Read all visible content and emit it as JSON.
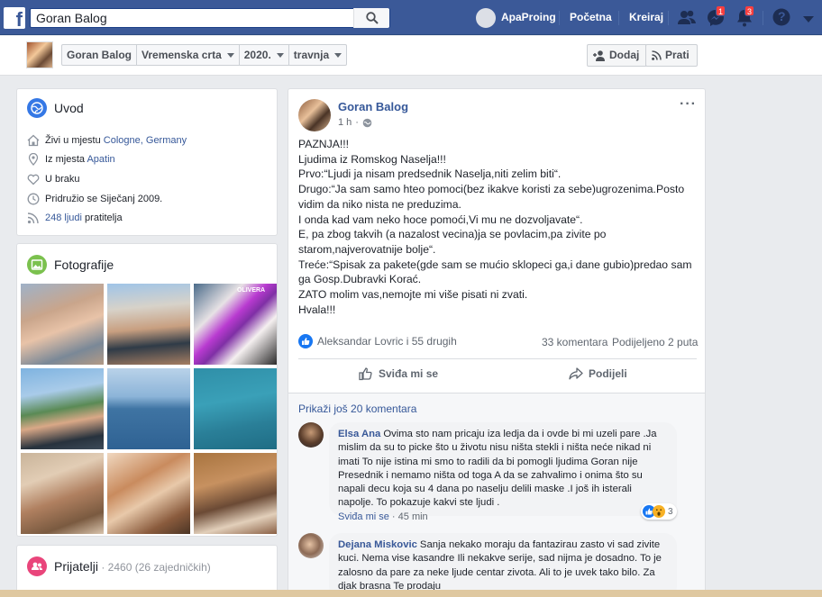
{
  "topbar": {
    "search_value": "Goran Balog",
    "profile_name": "ApaProing",
    "home_label": "Početna",
    "create_label": "Kreiraj",
    "messenger_badge": "1",
    "notifications_badge": "3",
    "help_glyph": "?",
    "icons": [
      "facebook-logo",
      "search-icon",
      "friends-icon",
      "messenger-icon",
      "bell-icon",
      "help-icon",
      "dropdown-icon"
    ]
  },
  "timeline_bar": {
    "name": "Goran Balog",
    "section": "Vremenska crta",
    "year": "2020.",
    "month": "travnja",
    "add_label": "Dodaj",
    "follow_label": "Prati"
  },
  "intro": {
    "title": "Uvod",
    "lives_prefix": "Živi u mjestu ",
    "lives_place": "Cologne, Germany",
    "from_prefix": "Iz mjesta ",
    "from_place": "Apatin",
    "relationship": "U braku",
    "joined": "Pridružio se Siječanj 2009.",
    "followers_link": "248 ljudi",
    "followers_suffix": " pratitelja"
  },
  "photos": {
    "title": "Fotografije",
    "collage_caption": "OLIVERA"
  },
  "friends": {
    "title": "Prijatelji",
    "count": " · 2460 (26 zajedničkih)"
  },
  "post": {
    "author": "Goran Balog",
    "time": "1 h",
    "lines": [
      "PAZNJA!!!",
      "Ljudima iz Romskog Naselja!!!",
      "Prvo:“Ljudi ja nisam predsednik Naselja,niti zelim biti“.",
      "Drugo:“Ja sam samo hteo pomoci(bez ikakve koristi za sebe)ugrozenima.Posto vidim da niko nista ne preduzima.",
      "I onda kad vam neko hoce pomoći,Vi mu ne dozvoljavate“.",
      "E, pa zbog takvih (a nazalost vecina)ja se povlacim,pa zivite po starom,najverovatnije bolje“.",
      "Treće:“Spisak za pakete(gde sam se mućio sklopeci ga,i dane gubio)predao sam ga Gosp.Dubravki Korać.",
      "ZATO molim vas,nemojte mi više pisati ni zvati.",
      "Hvala!!!"
    ],
    "reactions": "Aleksandar Lovric i 55 drugih",
    "comments_count": "33 komentara",
    "shares": "Podijeljeno 2 puta",
    "like_label": "Sviđa mi se",
    "share_label": "Podijeli",
    "more_comments": "Prikaži još 20 komentara",
    "options_glyph": "···"
  },
  "comments": [
    {
      "author": "Elsa Ana",
      "text": "Ovima sto nam pricaju iza ledja da i ovde bi mi uzeli pare .Ja mislim da su to picke što u životu nisu ništa stekli i ništa neće nikad ni imati To nije istina mi smo to radili da bi pomogli ljudima Goran nije Presednik i nemamo ništa od toga A da se zahvalimo i onima što su napali decu koja su 4 dana po naselju delili maske .I još ih isterali napolje. To pokazuje kakvi ste ljudi .",
      "like_label": "Sviđa mi se",
      "time": "45 min",
      "reaction_count": "3"
    },
    {
      "author": "Dejana Miskovic",
      "text": "Sanja nekako moraju da fantazirau zasto vi sad zivite kuci. Nema vise kasandre Ili nekakve serije, sad nijma je dosadno. To je zalosno da pare za neke ljude centar zivota. Ali to je uvek tako bilo. Za djak brasna Te prodaju"
    }
  ],
  "colors": {
    "brand": "#3b5998",
    "link": "#365899",
    "badge": "#fa3e3e",
    "page_bg": "#e9ebee"
  }
}
